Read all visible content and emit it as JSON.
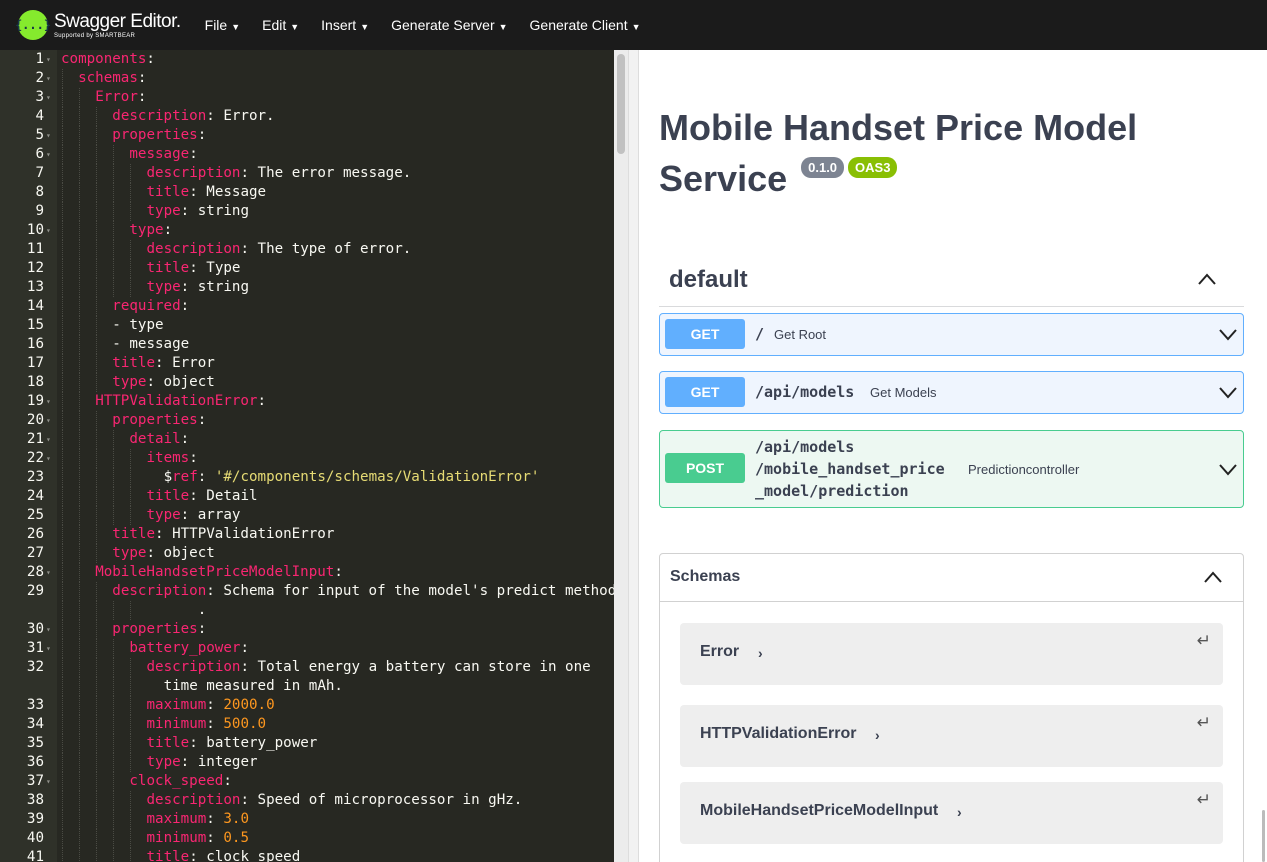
{
  "app": {
    "logo_mark": "{...}",
    "logo_title": "Swagger Editor.",
    "logo_sub": "Supported by SMARTBEAR",
    "menu": [
      "File",
      "Edit",
      "Insert",
      "Generate Server",
      "Generate Client"
    ]
  },
  "editor": {
    "lines": [
      {
        "n": "1",
        "f": true,
        "i": 0,
        "k": "components",
        "v": ""
      },
      {
        "n": "2",
        "f": true,
        "i": 1,
        "k": "schemas",
        "v": ""
      },
      {
        "n": "3",
        "f": true,
        "i": 2,
        "k": "Error",
        "v": ""
      },
      {
        "n": "4",
        "f": false,
        "i": 3,
        "k": "description",
        "v": "Error."
      },
      {
        "n": "5",
        "f": true,
        "i": 3,
        "k": "properties",
        "v": ""
      },
      {
        "n": "6",
        "f": true,
        "i": 4,
        "k": "message",
        "v": ""
      },
      {
        "n": "7",
        "f": false,
        "i": 5,
        "k": "description",
        "v": "The error message."
      },
      {
        "n": "8",
        "f": false,
        "i": 5,
        "k": "title",
        "v": "Message"
      },
      {
        "n": "9",
        "f": false,
        "i": 5,
        "k": "type",
        "v": "string"
      },
      {
        "n": "10",
        "f": true,
        "i": 4,
        "k": "type",
        "v": ""
      },
      {
        "n": "11",
        "f": false,
        "i": 5,
        "k": "description",
        "v": "The type of error."
      },
      {
        "n": "12",
        "f": false,
        "i": 5,
        "k": "title",
        "v": "Type"
      },
      {
        "n": "13",
        "f": false,
        "i": 5,
        "k": "type",
        "v": "string"
      },
      {
        "n": "14",
        "f": false,
        "i": 3,
        "k": "required",
        "v": ""
      },
      {
        "n": "15",
        "f": false,
        "i": 3,
        "raw": "- type"
      },
      {
        "n": "16",
        "f": false,
        "i": 3,
        "raw": "- message"
      },
      {
        "n": "17",
        "f": false,
        "i": 3,
        "k": "title",
        "v": "Error"
      },
      {
        "n": "18",
        "f": false,
        "i": 3,
        "k": "type",
        "v": "object"
      },
      {
        "n": "19",
        "f": true,
        "i": 2,
        "k": "HTTPValidationError",
        "v": ""
      },
      {
        "n": "20",
        "f": true,
        "i": 3,
        "k": "properties",
        "v": ""
      },
      {
        "n": "21",
        "f": true,
        "i": 4,
        "k": "detail",
        "v": ""
      },
      {
        "n": "22",
        "f": true,
        "i": 5,
        "k": "items",
        "v": ""
      },
      {
        "n": "23",
        "f": false,
        "i": 6,
        "ref": "$",
        "k": "ref",
        "s": "'#/components/schemas/ValidationError'"
      },
      {
        "n": "24",
        "f": false,
        "i": 5,
        "k": "title",
        "v": "Detail"
      },
      {
        "n": "25",
        "f": false,
        "i": 5,
        "k": "type",
        "v": "array"
      },
      {
        "n": "26",
        "f": false,
        "i": 3,
        "k": "title",
        "v": "HTTPValidationError"
      },
      {
        "n": "27",
        "f": false,
        "i": 3,
        "k": "type",
        "v": "object"
      },
      {
        "n": "28",
        "f": true,
        "i": 2,
        "k": "MobileHandsetPriceModelInput",
        "v": ""
      },
      {
        "n": "29",
        "f": false,
        "i": 3,
        "k": "description",
        "v": "Schema for input of the model's predict method"
      },
      {
        "n": "",
        "f": false,
        "i": 8,
        "raw": "."
      },
      {
        "n": "30",
        "f": true,
        "i": 3,
        "k": "properties",
        "v": ""
      },
      {
        "n": "31",
        "f": true,
        "i": 4,
        "k": "battery_power",
        "v": ""
      },
      {
        "n": "32",
        "f": false,
        "i": 5,
        "k": "description",
        "v": "Total energy a battery can store in one"
      },
      {
        "n": "",
        "f": false,
        "i": 6,
        "raw": "time measured in mAh."
      },
      {
        "n": "33",
        "f": false,
        "i": 5,
        "k": "maximum",
        "num": "2000.0"
      },
      {
        "n": "34",
        "f": false,
        "i": 5,
        "k": "minimum",
        "num": "500.0"
      },
      {
        "n": "35",
        "f": false,
        "i": 5,
        "k": "title",
        "v": "battery_power"
      },
      {
        "n": "36",
        "f": false,
        "i": 5,
        "k": "type",
        "v": "integer"
      },
      {
        "n": "37",
        "f": true,
        "i": 4,
        "k": "clock_speed",
        "v": ""
      },
      {
        "n": "38",
        "f": false,
        "i": 5,
        "k": "description",
        "v": "Speed of microprocessor in gHz."
      },
      {
        "n": "39",
        "f": false,
        "i": 5,
        "k": "maximum",
        "num": "3.0"
      },
      {
        "n": "40",
        "f": false,
        "i": 5,
        "k": "minimum",
        "num": "0.5"
      },
      {
        "n": "41",
        "f": false,
        "i": 5,
        "k": "title",
        "v": "clock_speed"
      }
    ]
  },
  "preview": {
    "title": "Mobile Handset Price Model Service",
    "version": "0.1.0",
    "oas": "OAS3",
    "tag": "default",
    "ops": [
      {
        "method": "GET",
        "path": "/",
        "summary": "Get Root"
      },
      {
        "method": "GET",
        "path": "/api/models",
        "summary": "Get Models"
      },
      {
        "method": "POST",
        "path_lines": [
          "/api/models",
          "/mobile_handset_price",
          "_model/prediction"
        ],
        "summary": "Predictioncontroller"
      }
    ],
    "schemas_title": "Schemas",
    "models": [
      "Error",
      "HTTPValidationError",
      "MobileHandsetPriceModelInput"
    ]
  },
  "colors": {
    "get": "#61affe",
    "post": "#49cc90",
    "editor_bg": "#272822",
    "yaml_key": "#f92672",
    "yaml_number": "#fd971f",
    "yaml_string": "#e6db74"
  }
}
